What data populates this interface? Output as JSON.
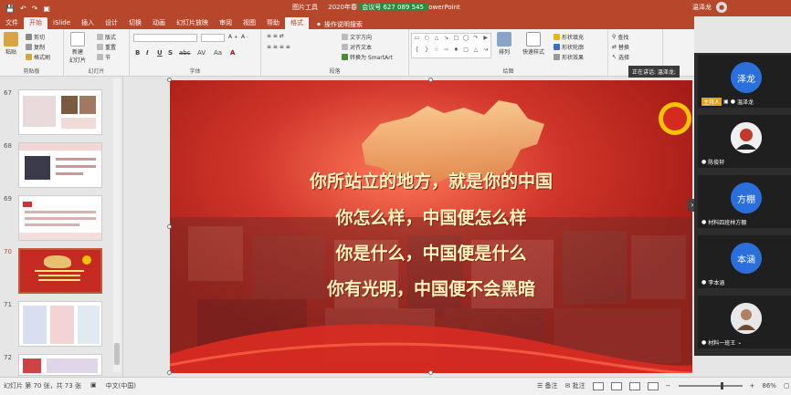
{
  "titlebar": {
    "context_tab": "图片工具",
    "title_text": "2020年春",
    "meeting_id": "会议号 627 089 545",
    "app_suffix": "owerPoint",
    "user_name": "温泽龙",
    "qa_icons": [
      "save-icon",
      "undo-icon",
      "redo-icon",
      "present-icon"
    ]
  },
  "tabs": [
    {
      "label": "文件",
      "active": false
    },
    {
      "label": "开始",
      "active": true
    },
    {
      "label": "iSlide",
      "active": false
    },
    {
      "label": "插入",
      "active": false
    },
    {
      "label": "设计",
      "active": false
    },
    {
      "label": "切换",
      "active": false
    },
    {
      "label": "动画",
      "active": false
    },
    {
      "label": "幻灯片放映",
      "active": false
    },
    {
      "label": "审阅",
      "active": false
    },
    {
      "label": "视图",
      "active": false
    },
    {
      "label": "帮助",
      "active": false
    },
    {
      "label": "格式",
      "active": false
    }
  ],
  "search": {
    "label": "操作说明搜索"
  },
  "ribbon": {
    "clipboard": {
      "group_label": "剪贴板",
      "paste": "粘贴",
      "cut": "剪切",
      "copy": "复制",
      "format_painter": "格式刷"
    },
    "slides": {
      "group_label": "幻灯片",
      "new_slide": "新建",
      "new_slide_2": "幻灯片",
      "layout": "版式",
      "reset": "重置",
      "section": "节"
    },
    "font": {
      "group_label": "字体",
      "buttons": [
        "B",
        "I",
        "U",
        "S",
        "abc",
        "AV",
        "Aa",
        "A"
      ]
    },
    "paragraph": {
      "group_label": "段落",
      "text_direction": "文字方向",
      "align_text": "对齐文本",
      "smartart": "转换为 SmartArt"
    },
    "drawing": {
      "group_label": "绘图",
      "arrange": "排列",
      "quick_styles": "快速样式",
      "shape_fill": "形状填充",
      "shape_outline": "形状轮廓",
      "shape_effects": "形状效果"
    },
    "editing": {
      "group_label": "编辑",
      "find": "查找",
      "replace": "替换",
      "select": "选择"
    }
  },
  "thumbnails": [
    {
      "number": "67",
      "selected": false
    },
    {
      "number": "68",
      "selected": false
    },
    {
      "number": "69",
      "selected": false
    },
    {
      "number": "70",
      "selected": true
    },
    {
      "number": "71",
      "selected": false
    },
    {
      "number": "72",
      "selected": false
    }
  ],
  "slide": {
    "lines": [
      "你所站立的地方，就是你的中国",
      "你怎么样，中国便怎么样",
      "你是什么，中国便是什么",
      "你有光明，中国便不会黑暗"
    ],
    "banner_text": "正在讲话: 温泽龙;",
    "bg_color": "#c42a22",
    "text_color": "#fff6c0"
  },
  "meeting": {
    "participants": [
      {
        "avatar_text": "泽龙",
        "name": "温泽龙",
        "badge": "主持人",
        "avatar_type": "text"
      },
      {
        "avatar_text": "",
        "name": "陈俊轩",
        "badge": "",
        "avatar_type": "image"
      },
      {
        "avatar_text": "方棚",
        "name": "材料四班林方棚",
        "badge": "",
        "avatar_type": "text"
      },
      {
        "avatar_text": "本涵",
        "name": "李本涵",
        "badge": "",
        "avatar_type": "text"
      },
      {
        "avatar_text": "",
        "name": "材料一班王",
        "badge": "",
        "avatar_type": "image"
      }
    ],
    "accent_color": "#2a6fdb"
  },
  "statusbar": {
    "slide_info": "幻灯片 第 70 张，共 73 张",
    "language": "中文(中国)",
    "notes": "备注",
    "comments": "批注",
    "zoom": "86%"
  }
}
